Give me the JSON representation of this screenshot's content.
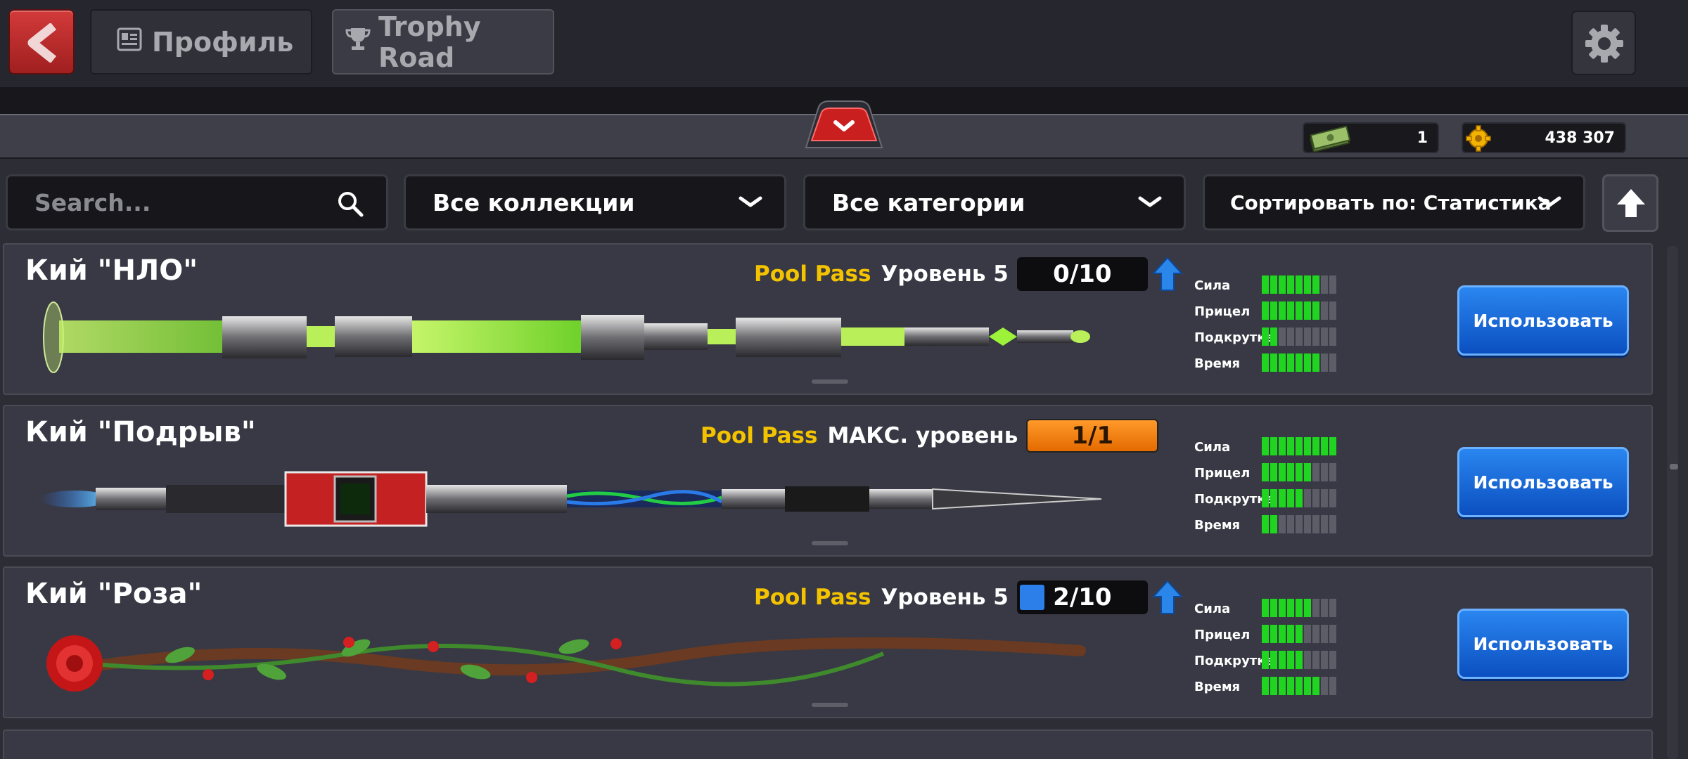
{
  "header": {
    "tabs": [
      {
        "label": "Профиль",
        "icon": "profile-card-icon"
      },
      {
        "label": "Trophy Road",
        "icon": "trophy-icon"
      }
    ]
  },
  "currency": {
    "cash": "1",
    "coins": "438 307"
  },
  "filters": {
    "search_placeholder": "Search...",
    "collection": "Все коллекции",
    "category": "Все категории",
    "sort": "Сортировать по: Статистика"
  },
  "stat_labels": [
    "Сила",
    "Прицел",
    "Подкрутка",
    "Время"
  ],
  "cues": [
    {
      "name": "Кий \"НЛО\"",
      "pass": "Pool Pass",
      "level": "Уровень 5",
      "progress": "0/10",
      "progress_fraction": 0.0,
      "upgradable": true,
      "stats": [
        7,
        7,
        2,
        7
      ],
      "action": "Использовать"
    },
    {
      "name": "Кий \"Подрыв\"",
      "pass": "Pool Pass",
      "level": "МАКС. уровень",
      "progress": "1/1",
      "progress_fraction": 1.0,
      "upgradable": false,
      "stats": [
        9,
        6,
        5,
        2
      ],
      "action": "Использовать"
    },
    {
      "name": "Кий \"Роза\"",
      "pass": "Pool Pass",
      "level": "Уровень 5",
      "progress": "2/10",
      "progress_fraction": 0.2,
      "upgradable": true,
      "stats": [
        6,
        5,
        5,
        7
      ],
      "action": "Использовать"
    }
  ],
  "stat_max": 9,
  "colors": {
    "accent": "#f4c300",
    "use_button": "#1a6ad8",
    "back_button": "#c22b2b",
    "stat_on": "#1fd51f"
  }
}
